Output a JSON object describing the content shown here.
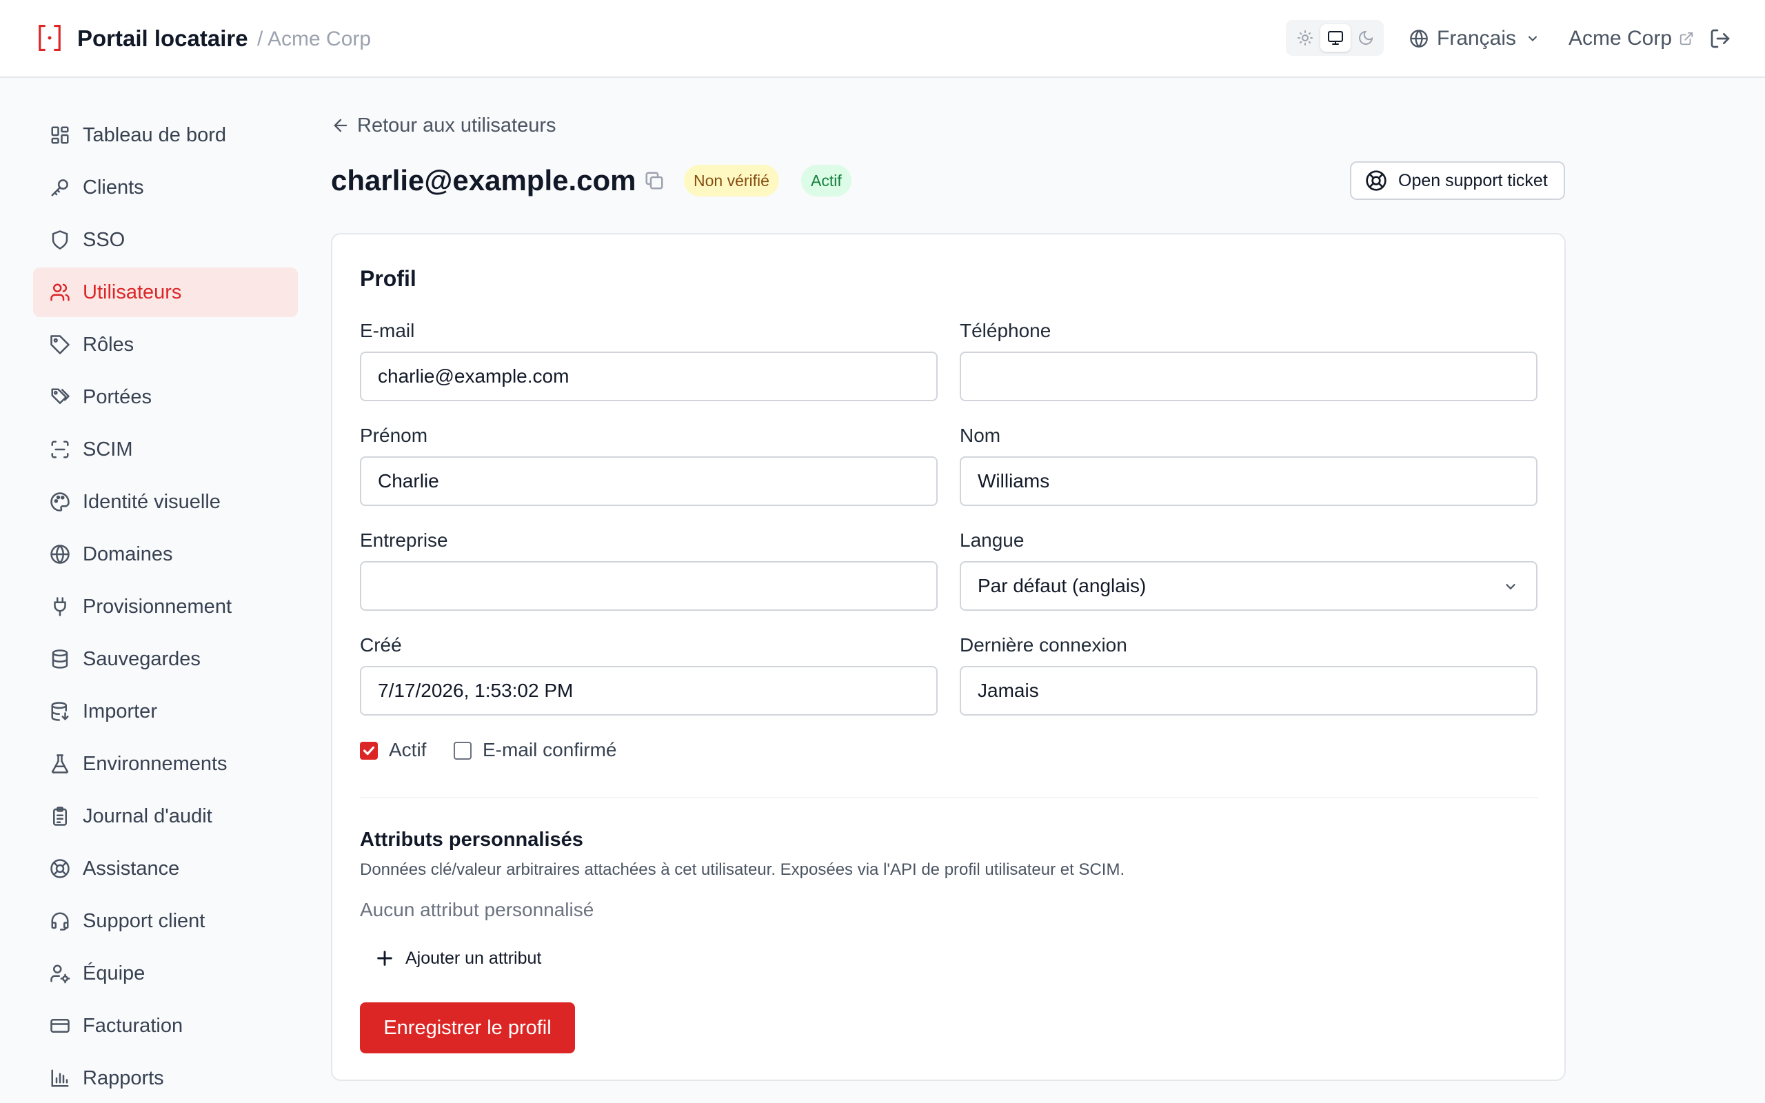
{
  "header": {
    "title": "Portail locataire",
    "org": "/ Acme Corp",
    "language": "Français",
    "org_link": "Acme Corp"
  },
  "theme_toggle": {
    "options": [
      "sun-icon",
      "monitor-icon",
      "moon-icon"
    ],
    "selected": "monitor-icon"
  },
  "sidebar": {
    "items": [
      {
        "label": "Tableau de bord",
        "icon": "dashboard-icon"
      },
      {
        "label": "Clients",
        "icon": "key-icon"
      },
      {
        "label": "SSO",
        "icon": "shield-icon"
      },
      {
        "label": "Utilisateurs",
        "icon": "users-icon",
        "active": true
      },
      {
        "label": "Rôles",
        "icon": "tag-icon"
      },
      {
        "label": "Portées",
        "icon": "tags-icon"
      },
      {
        "label": "SCIM",
        "icon": "scan-icon"
      },
      {
        "label": "Identité visuelle",
        "icon": "palette-icon"
      },
      {
        "label": "Domaines",
        "icon": "globe-icon"
      },
      {
        "label": "Provisionnement",
        "icon": "plug-icon"
      },
      {
        "label": "Sauvegardes",
        "icon": "database-icon"
      },
      {
        "label": "Importer",
        "icon": "database-import-icon"
      },
      {
        "label": "Environnements",
        "icon": "flask-icon"
      },
      {
        "label": "Journal d'audit",
        "icon": "clipboard-icon"
      },
      {
        "label": "Assistance",
        "icon": "lifebuoy-icon"
      },
      {
        "label": "Support client",
        "icon": "headset-icon"
      },
      {
        "label": "Équipe",
        "icon": "user-gear-icon"
      },
      {
        "label": "Facturation",
        "icon": "card-icon"
      },
      {
        "label": "Rapports",
        "icon": "bar-chart-icon"
      }
    ]
  },
  "main": {
    "back_label": "Retour aux utilisateurs",
    "title": "charlie@example.com",
    "badges": {
      "unverified": "Non vérifié",
      "active": "Actif"
    },
    "support_button": "Open support ticket"
  },
  "profile": {
    "title": "Profil",
    "email_label": "E-mail",
    "email_value": "charlie@example.com",
    "phone_label": "Téléphone",
    "phone_value": "",
    "firstname_label": "Prénom",
    "firstname_value": "Charlie",
    "lastname_label": "Nom",
    "lastname_value": "Williams",
    "company_label": "Entreprise",
    "company_value": "",
    "language_label": "Langue",
    "language_value": "Par défaut (anglais)",
    "created_label": "Créé",
    "created_value": "7/17/2026, 1:53:02 PM",
    "lastlogin_label": "Dernière connexion",
    "lastlogin_value": "Jamais",
    "active_checkbox": {
      "label": "Actif",
      "checked": true
    },
    "email_confirmed_checkbox": {
      "label": "E-mail confirmé",
      "checked": false
    },
    "custom_attrs_title": "Attributs personnalisés",
    "custom_attrs_desc": "Données clé/valeur arbitraires attachées à cet utilisateur. Exposées via l'API de profil utilisateur et SCIM.",
    "custom_attrs_empty": "Aucun attribut personnalisé",
    "add_attr_label": "Ajouter un attribut",
    "save_label": "Enregistrer le profil"
  },
  "colors": {
    "accent": "#dc2626",
    "active_nav_bg": "#fce7e7",
    "warn_badge_bg": "#fef9c3",
    "ok_badge_bg": "#dcfce7"
  }
}
